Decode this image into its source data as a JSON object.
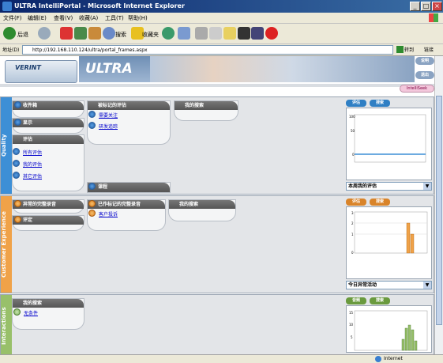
{
  "window": {
    "title": "ULTRA IntelliPortal - Microsoft Internet Explorer"
  },
  "menu": [
    "文件(F)",
    "编辑(E)",
    "查看(V)",
    "收藏(A)",
    "工具(T)",
    "帮助(H)"
  ],
  "toolbar": {
    "back": "后退",
    "search": "搜索",
    "favorites": "收藏夹"
  },
  "address": {
    "label": "地址(D)",
    "url": "http://192.168.110.124/ultra/portal_frames.aspx",
    "go": "转到",
    "links": "链接"
  },
  "header": {
    "logo": "VERINT",
    "product": "ULTRA",
    "help": "说明",
    "logout": "退出",
    "intelliseek": "IntelliSeek"
  },
  "quality": {
    "label": "Quality",
    "inbox": "收件箱",
    "task": "显示",
    "eval_header": "评估",
    "evals": [
      "所有评估",
      "我的评估",
      "其它评估"
    ],
    "flagged_header": "被标记的评估",
    "flagged": [
      "需要关注",
      "研发追踪"
    ],
    "search_header": "我的搜索",
    "course": "课程",
    "tabs": [
      "评估",
      "搜索"
    ],
    "chart_select": "本周我的评估"
  },
  "cx": {
    "label": "Customer Experience",
    "incomplete": "异常的完整录音",
    "assess": "评定",
    "flagged_header": "已作标记的完整录音",
    "flagged": [
      "客户投诉"
    ],
    "search_header": "我的搜索",
    "tabs": [
      "评估",
      "搜索"
    ],
    "chart_select": "今日异常活动"
  },
  "interactions": {
    "label": "Interactions",
    "search_header": "我的搜索",
    "items": [
      "无条件"
    ],
    "tabs": [
      "音频",
      "搜索"
    ]
  },
  "status": {
    "zone": "Internet"
  },
  "colors": {
    "quality": "#3d8fd6",
    "cx": "#f0a248",
    "interactions": "#98c06a"
  }
}
